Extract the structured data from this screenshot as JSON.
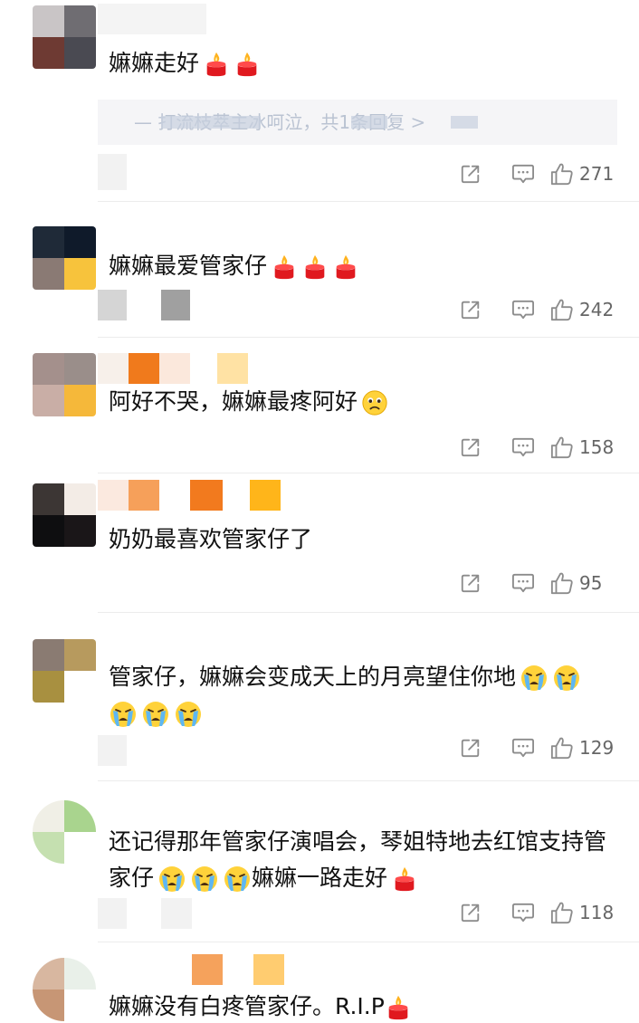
{
  "comments": [
    {
      "text": "嫲嫲走好",
      "likes": "271",
      "reply_preview": "— 打流枝萃主冰呵泣，共1条回复 >"
    },
    {
      "text": "嫲嫲最爱管家仔",
      "likes": "242"
    },
    {
      "text": "阿好不哭，嫲嫲最疼阿好",
      "likes": "158"
    },
    {
      "text": "奶奶最喜欢管家仔了",
      "likes": "95"
    },
    {
      "text": "管家仔，嫲嫲会变成天上的月亮望住你地",
      "likes": "129"
    },
    {
      "text": "还记得那年管家仔演唱会，琴姐特地去红馆支持管家仔",
      "text_line2": "嫲嫲一路走好",
      "likes": "118"
    },
    {
      "text": "嫲嫲没有白疼管家仔。R.I.P"
    }
  ],
  "colors": {
    "candle_red": "#e8262b",
    "flame": "#ffb21e",
    "icon_gray": "#8c8c8c"
  },
  "icons": [
    "candle-emoji",
    "crying-emoji",
    "sad-emoji",
    "share-icon",
    "reply-icon",
    "thumbs-up-icon"
  ]
}
